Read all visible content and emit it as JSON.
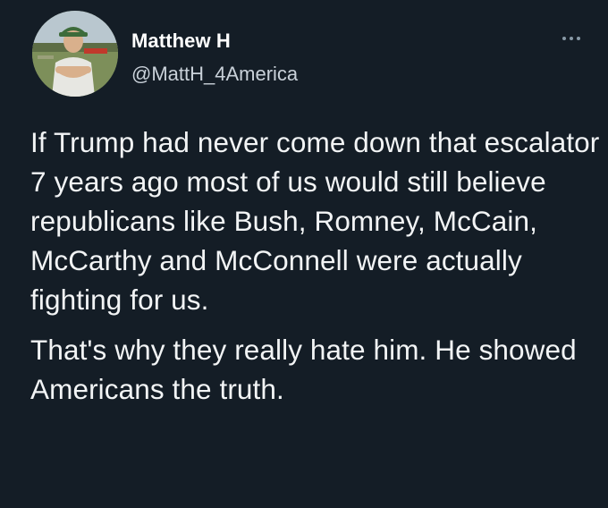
{
  "tweet": {
    "author": {
      "display_name": "Matthew H",
      "handle": "@MattH_4America",
      "avatar_icon": "profile-photo"
    },
    "more_icon": "ellipsis-icon",
    "paragraphs": [
      "If Trump had never come down that escalator 7 years ago most of us would still believe republicans like Bush, Romney, McCain, McCarthy and McConnell were actually fighting for us.",
      "That's why they really hate him. He showed Americans the truth."
    ]
  },
  "colors": {
    "background": "#141d26",
    "text": "#ffffff",
    "secondary_text": "#c9d1d9",
    "icon": "#8899a6"
  }
}
